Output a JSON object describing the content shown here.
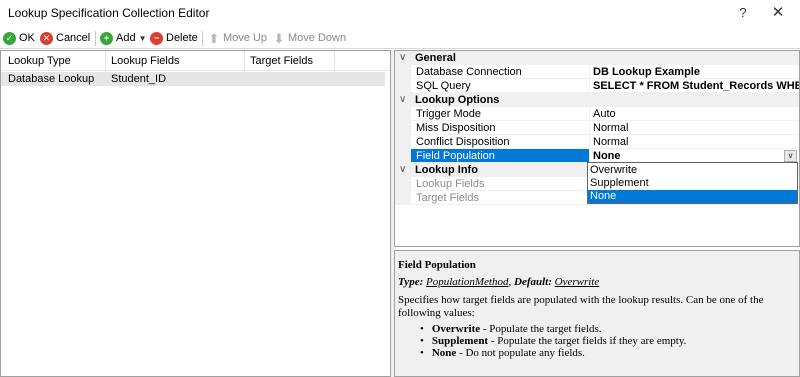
{
  "window": {
    "title": "Lookup Specification Collection Editor",
    "help_button": "?",
    "close_button": "✕"
  },
  "toolbar": {
    "ok_label": "OK",
    "cancel_label": "Cancel",
    "add_label": "Add",
    "delete_label": "Delete",
    "move_up_label": "Move Up",
    "move_down_label": "Move Down"
  },
  "list": {
    "columns": [
      "Lookup Type",
      "Lookup Fields",
      "Target Fields"
    ],
    "rows": [
      {
        "lookup_type": "Database Lookup",
        "lookup_fields": "Student_ID",
        "target_fields": ""
      }
    ]
  },
  "property_grid": {
    "general": {
      "label": "General",
      "database_connection": {
        "name": "Database Connection",
        "value": "DB Lookup Example"
      },
      "sql_query": {
        "name": "SQL Query",
        "value": "SELECT * FROM Student_Records WHER"
      }
    },
    "lookup_options": {
      "label": "Lookup Options",
      "trigger_mode": {
        "name": "Trigger Mode",
        "value": "Auto"
      },
      "miss_disposition": {
        "name": "Miss Disposition",
        "value": "Normal"
      },
      "conflict_disposition": {
        "name": "Conflict Disposition",
        "value": "Normal"
      },
      "field_population": {
        "name": "Field Population",
        "value": "None"
      }
    },
    "lookup_info": {
      "label": "Lookup Info",
      "lookup_fields": {
        "name": "Lookup Fields",
        "value": ""
      },
      "target_fields": {
        "name": "Target Fields",
        "value": ""
      }
    }
  },
  "dropdown": {
    "options": [
      "Overwrite",
      "Supplement",
      "None"
    ],
    "selected": "None"
  },
  "help": {
    "title": "Field Population",
    "type_prefix": "Type:",
    "type_value": "PopulationMethod",
    "default_prefix": "Default:",
    "default_value": "Overwrite",
    "description": "Specifies how target fields are populated with the lookup results. Can be one of the following values:",
    "items": [
      {
        "term": "Overwrite",
        "text": " - Populate the target fields."
      },
      {
        "term": "Supplement",
        "text": " - Populate the target fields if they are empty."
      },
      {
        "term": "None",
        "text": " - Do not populate any fields."
      }
    ]
  },
  "colors": {
    "selection": "#0078d7",
    "ok_icon": "#3aa63a",
    "cancel_icon": "#d9412e"
  },
  "icons": [
    "check-icon",
    "cancel-icon",
    "add-icon",
    "delete-icon",
    "arrow-up-icon",
    "arrow-down-icon",
    "expand-icon",
    "dropdown-arrow-icon"
  ]
}
